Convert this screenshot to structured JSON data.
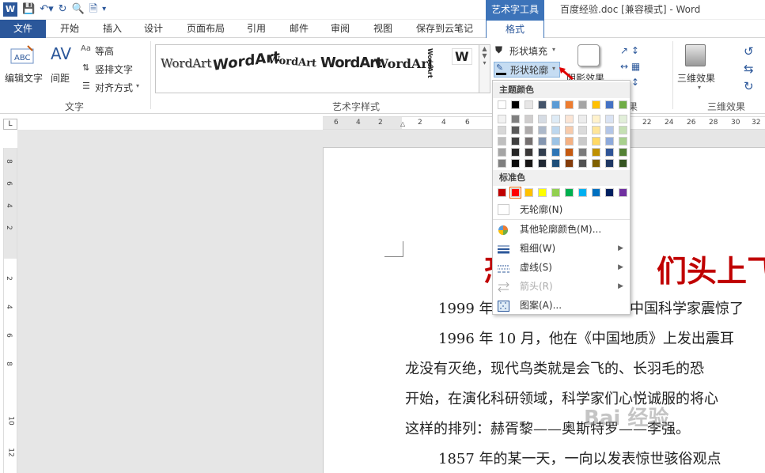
{
  "titlebar": {
    "context_tool": "艺术字工具",
    "doc_title": "百度经验.doc [兼容模式] - Word"
  },
  "tabs": [
    "文件",
    "开始",
    "插入",
    "设计",
    "页面布局",
    "引用",
    "邮件",
    "审阅",
    "视图",
    "保存到云笔记",
    "格式"
  ],
  "ribbon": {
    "text_group": {
      "edit_text": "编辑文字",
      "spacing_icon_text": "AV",
      "spacing": "间距",
      "equal_height_icon": "Aa",
      "equal_height": "等高",
      "vertical_text": "竖排文字",
      "align": "对齐方式",
      "label": "文字",
      "edit_icon_text": "ABC"
    },
    "wordart_group": {
      "label": "艺术字样式",
      "samples": [
        "WordArt",
        "WordArt",
        "WordArt",
        "WordArt",
        "WordArt",
        "WordArt",
        "W"
      ]
    },
    "shape_fill": "形状填充",
    "shape_outline": "形状轮廓",
    "shadow_effect": "阴影效果",
    "three_d": "三维效果",
    "three_d_label": "三维效果",
    "group_fragment": "果"
  },
  "ruler": {
    "h_ticks": [
      "6",
      "4",
      "2",
      "2",
      "4",
      "6",
      "22",
      "24",
      "26",
      "28",
      "30",
      "32"
    ],
    "v_ticks": [
      "8",
      "6",
      "4",
      "2",
      "2",
      "4",
      "6",
      "8",
      "10",
      "12"
    ],
    "corner": "L"
  },
  "document": {
    "title_partial": "恐",
    "title_tail": "们头上飞",
    "lines": [
      "1999 年",
      "中国科学家震惊了",
      "1996 年 10 月，他在《中国地质》上发出震耳",
      "龙没有灭绝，现代鸟类就是会飞的、长羽毛的恐",
      "开始，在演化科研领域，科学家们心悦诚服的将心",
      "这样的排列：赫胥黎——奥斯特罗——李强。",
      "1857 年的某一天，一向以发表惊世骇俗观点"
    ]
  },
  "dropdown": {
    "theme_colors_label": "主题颜色",
    "standard_colors_label": "标准色",
    "no_outline": "无轮廓(N)",
    "more_colors": "其他轮廓颜色(M)...",
    "weight": "粗细(W)",
    "dashes": "虚线(S)",
    "arrows": "箭头(R)",
    "pattern": "图案(A)...",
    "theme_top": [
      "#ffffff",
      "#000000",
      "#e7e6e6",
      "#44546a",
      "#5b9bd5",
      "#ed7d31",
      "#a5a5a5",
      "#ffc000",
      "#4472c4",
      "#70ad47"
    ],
    "theme_shades": [
      [
        "#f2f2f2",
        "#7f7f7f",
        "#d0cece",
        "#d6dce4",
        "#deebf6",
        "#fbe5d5",
        "#ededed",
        "#fff2cc",
        "#dae3f3",
        "#e2efd9"
      ],
      [
        "#d8d8d8",
        "#595959",
        "#aeabab",
        "#adb9ca",
        "#bdd7ee",
        "#f7cbac",
        "#dbdbdb",
        "#fee599",
        "#b4c6e7",
        "#c5e0b3"
      ],
      [
        "#bfbfbf",
        "#3f3f3f",
        "#757070",
        "#8496b0",
        "#9cc3e5",
        "#f4b183",
        "#c9c9c9",
        "#ffd965",
        "#8eaadb",
        "#a8d08d"
      ],
      [
        "#a5a5a5",
        "#262626",
        "#3a3838",
        "#323f4f",
        "#2e75b5",
        "#c55a11",
        "#7b7b7b",
        "#bf9000",
        "#2f5496",
        "#538135"
      ],
      [
        "#7f7f7f",
        "#0c0c0c",
        "#171616",
        "#222a35",
        "#1e4e79",
        "#843c0b",
        "#525252",
        "#7f6000",
        "#1f3864",
        "#375623"
      ]
    ],
    "standard": [
      "#c00000",
      "#ff0000",
      "#ffc000",
      "#ffff00",
      "#92d050",
      "#00b050",
      "#00b0f0",
      "#0070c0",
      "#002060",
      "#7030a0"
    ]
  },
  "watermark": "Bai 经验"
}
